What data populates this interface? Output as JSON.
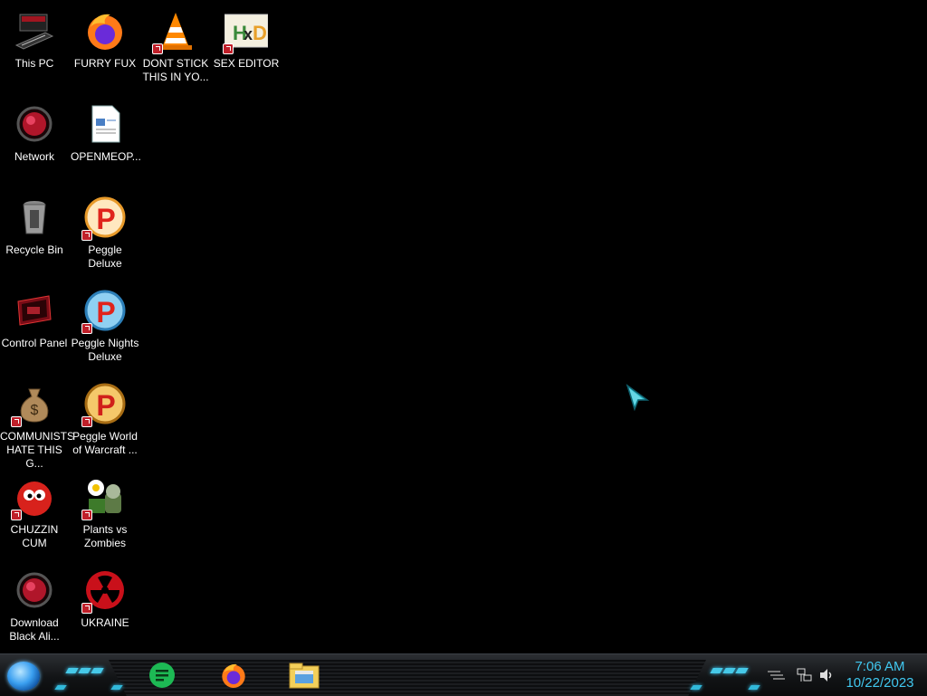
{
  "desktop": {
    "icons": [
      {
        "label": "This PC",
        "icon": "computer-icon"
      },
      {
        "label": "FURRY FUX",
        "icon": "firefox-icon"
      },
      {
        "label": "DONT STICK THIS IN YO...",
        "icon": "vlc-icon"
      },
      {
        "label": "SEX EDITOR",
        "icon": "hxd-icon"
      },
      {
        "label": "Network",
        "icon": "network-icon"
      },
      {
        "label": "OPENMEOP...",
        "icon": "document-icon"
      },
      {
        "label": "Recycle Bin",
        "icon": "recycle-bin-icon"
      },
      {
        "label": "Peggle Deluxe",
        "icon": "peggle-icon"
      },
      {
        "label": "Control Panel",
        "icon": "control-panel-icon"
      },
      {
        "label": "Peggle Nights Deluxe",
        "icon": "peggle-nights-icon"
      },
      {
        "label": "COMMUNISTS HATE THIS G...",
        "icon": "money-bag-icon"
      },
      {
        "label": "Peggle World of Warcraft ...",
        "icon": "peggle-wow-icon"
      },
      {
        "label": "CHUZZIN CUM",
        "icon": "chuzzle-icon"
      },
      {
        "label": "Plants vs Zombies",
        "icon": "pvz-icon"
      },
      {
        "label": "Download Black Ali...",
        "icon": "alienware-icon"
      },
      {
        "label": "UKRAINE",
        "icon": "radiation-icon"
      }
    ]
  },
  "taskbar": {
    "pinned": [
      "notes-app-icon",
      "firefox-icon",
      "file-explorer-icon"
    ],
    "clock": {
      "time": "7:06 AM",
      "date": "10/22/2023"
    }
  },
  "colors": {
    "accent": "#41c8f0",
    "background": "#000000"
  }
}
